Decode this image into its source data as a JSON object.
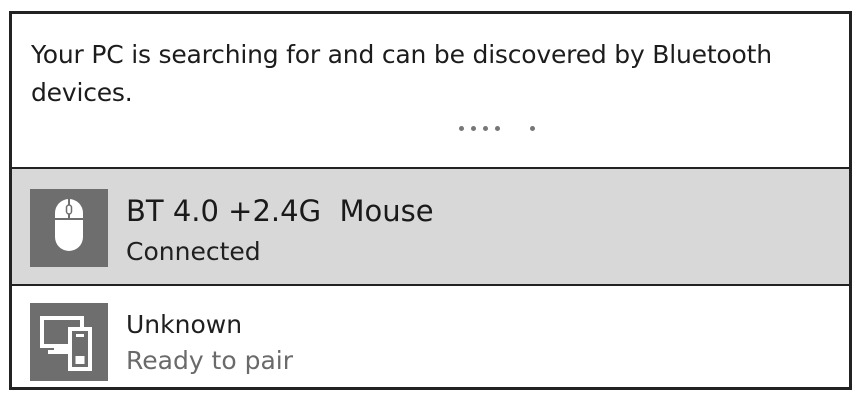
{
  "status": {
    "message": "Your PC is searching for and can be discovered by Bluetooth devices."
  },
  "devices": [
    {
      "name": "BT 4.0 +2.4G  Mouse",
      "state": "Connected",
      "icon": "mouse-icon",
      "selected": true
    },
    {
      "name": "Unknown",
      "state": "Ready to pair",
      "icon": "generic-device-icon",
      "selected": false
    }
  ],
  "colors": {
    "selected_row": "#d8d8d8",
    "icon_tile": "#6e6e6e",
    "border": "#222222",
    "secondary_text": "#6a6a6a"
  }
}
